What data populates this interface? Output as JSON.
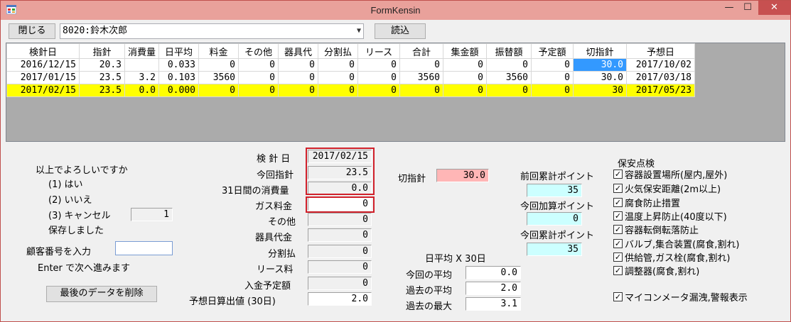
{
  "window": {
    "title": "FormKensin",
    "min_glyph": "—",
    "max_glyph": "☐",
    "close_glyph": "✕"
  },
  "toolbar": {
    "close_label": "閉じる",
    "customer_value": "8020:鈴木次郎",
    "load_label": "読込"
  },
  "grid": {
    "headers": [
      "検針日",
      "指針",
      "消費量",
      "日平均",
      "料金",
      "その他",
      "器具代",
      "分割払",
      "リース",
      "合計",
      "集金額",
      "振替額",
      "予定額",
      "切指針",
      "予想日"
    ],
    "rows": [
      [
        "2016/12/15",
        "20.3",
        "",
        "0.033",
        "0",
        "0",
        "0",
        "0",
        "0",
        "0",
        "0",
        "0",
        "0",
        "30.0",
        "2017/10/02"
      ],
      [
        "2017/01/15",
        "23.5",
        "3.2",
        "0.103",
        "3560",
        "0",
        "0",
        "0",
        "0",
        "3560",
        "0",
        "3560",
        "0",
        "30.0",
        "2017/03/18"
      ],
      [
        "2017/02/15",
        "23.5",
        "0.0",
        "0.000",
        "0",
        "0",
        "0",
        "0",
        "0",
        "0",
        "0",
        "0",
        "0",
        "30",
        "2017/05/23"
      ]
    ],
    "selected_row": 2
  },
  "prompt": {
    "question": "以上でよろしいですか",
    "opt1": "(1) はい",
    "opt2": "(2) いいえ",
    "opt3": "(3) キャンセル",
    "choice_value": "1",
    "saved": "保存しました",
    "customer_no_label": "顧客番号を入力",
    "enter_hint": "Enter で次へ進みます",
    "delete_last_label": "最後のデータを削除"
  },
  "details": {
    "inspect_date_label": "検 針 日",
    "inspect_date_value": "2017/02/15",
    "current_reading_label": "今回指針",
    "current_reading_value": "23.5",
    "usage_31_label": "31日間の消費量",
    "usage_31_value": "0.0",
    "gas_fee_label": "ガス料金",
    "gas_fee_value": "0",
    "other_label": "その他",
    "other_value": "0",
    "device_fee_label": "器具代金",
    "device_fee_value": "0",
    "installment_label": "分割払",
    "installment_value": "0",
    "lease_label": "リース料",
    "lease_value": "0",
    "deposit_plan_label": "入金予定額",
    "deposit_plan_value": "0",
    "forecast_label": "予想日算出値 (30日)",
    "forecast_value": "2.0"
  },
  "cutoff": {
    "label": "切指針",
    "value": "30.0"
  },
  "points": {
    "prev_label": "前回累計ポイント",
    "prev_value": "35",
    "add_label": "今回加算ポイント",
    "add_value": "0",
    "current_label": "今回累計ポイント",
    "current_value": "35"
  },
  "daily_avg": {
    "title": "日平均 X 30日",
    "current_label": "今回の平均",
    "current_value": "0.0",
    "past_label": "過去の平均",
    "past_value": "2.0",
    "max_label": "過去の最大",
    "max_value": "3.1"
  },
  "safety": {
    "title": "保安点検",
    "items": [
      "容器設置場所(屋内,屋外)",
      "火気保安距離(2m以上)",
      "腐食防止措置",
      "温度上昇防止(40度以下)",
      "容器転倒転落防止",
      "バルブ,集合装置(腐食,割れ)",
      "供給管,ガス栓(腐食,割れ)",
      "調整器(腐食,割れ)"
    ],
    "meter_alarm": "マイコンメータ漏洩,警報表示",
    "check_glyph": "✓"
  },
  "colors": {
    "titlebar": "#e9a19b",
    "selected_row": "#ffff00",
    "highlight_cell": "#3399ff",
    "red_box": "#d0202a",
    "cyan_field": "#ccffff",
    "pink_field": "#ffb6b6"
  }
}
